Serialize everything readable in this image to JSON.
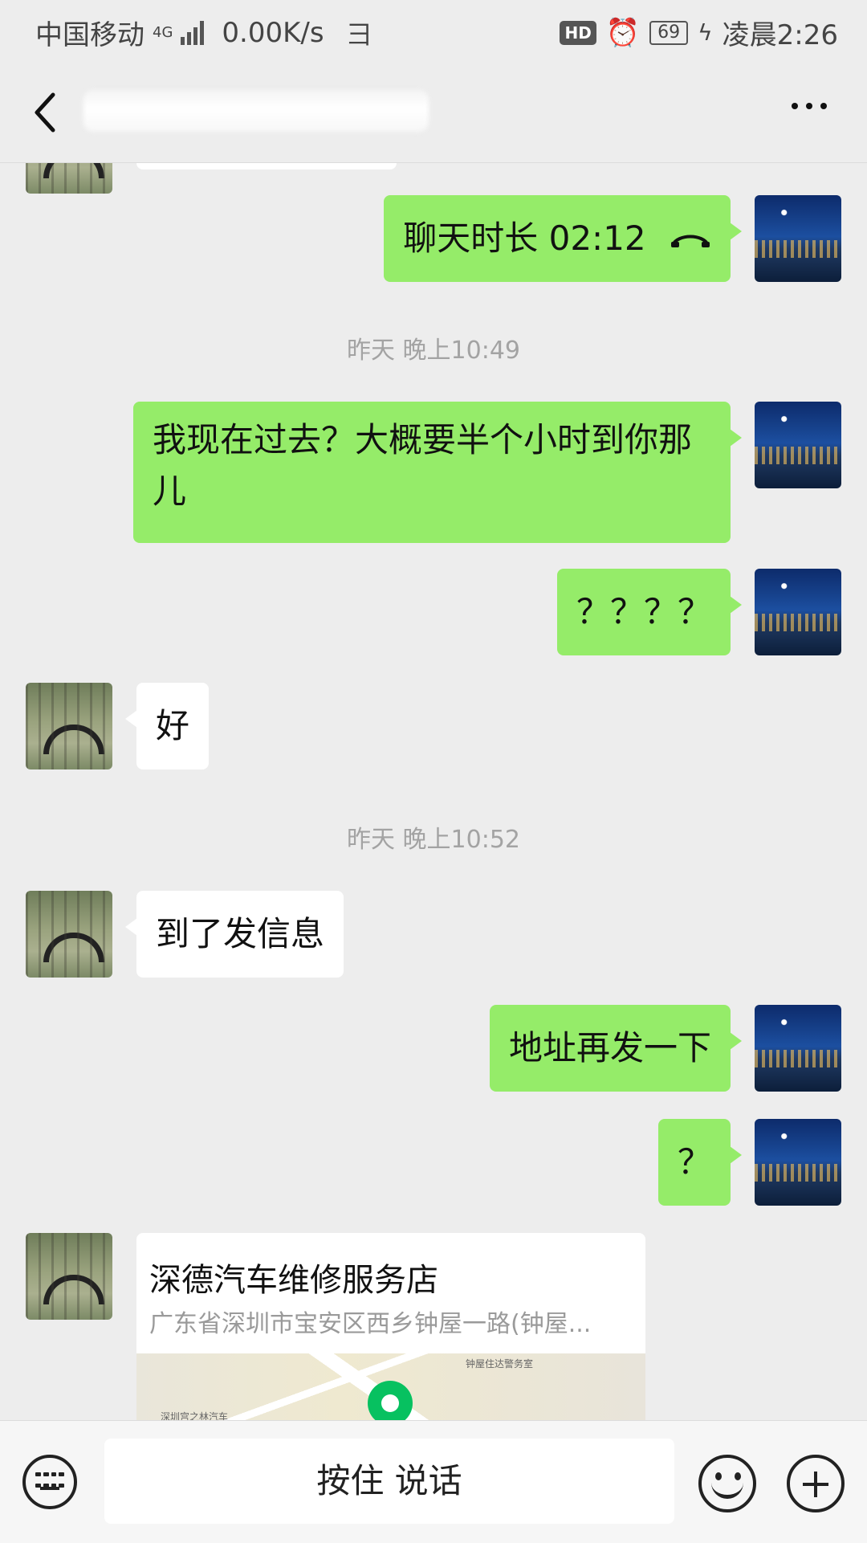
{
  "status_bar": {
    "carrier": "中国移动",
    "network": "4G",
    "speed": "0.00K/s",
    "hd": "HD",
    "battery": "69",
    "time": "凌晨2:26"
  },
  "nav": {
    "title": "",
    "icons": [
      "back-icon",
      "more-icon"
    ]
  },
  "messages": {
    "call": {
      "text": "聊天时长 02:12"
    },
    "ts1": "昨天 晚上10:49",
    "m1": "我现在过去？大概要半个小时到你那儿",
    "m2": "？？？？",
    "m3": "好",
    "ts2": "昨天 晚上10:52",
    "m4": "到了发信息",
    "m5": "地址再发一下",
    "m6": "？",
    "location": {
      "title": "深德汽车维修服务店",
      "address": "广东省深圳市宝安区西乡钟屋一路(钟屋...",
      "map_labels": [
        "深圳宫之林汽车",
        "钟屋住达警务室"
      ]
    }
  },
  "input_bar": {
    "voice_label": "按住 说话",
    "icons": [
      "keyboard-icon",
      "emoji-icon",
      "plus-icon"
    ]
  },
  "colors": {
    "outgoing_bubble": "#95ec69",
    "incoming_bubble": "#ffffff",
    "background": "#ededed",
    "map_pin": "#07c160"
  }
}
